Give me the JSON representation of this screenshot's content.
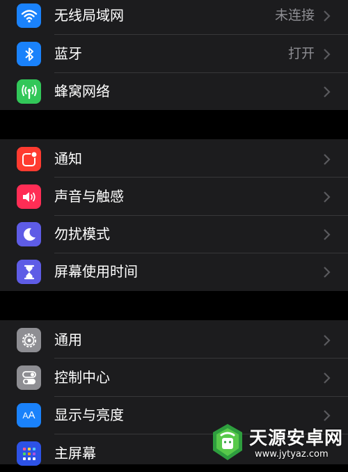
{
  "groups": [
    {
      "rows": [
        {
          "label": "无线局域网",
          "value": "未连接",
          "icon": "wifi-icon",
          "color": "#1a82fb"
        },
        {
          "label": "蓝牙",
          "value": "打开",
          "icon": "bluetooth-icon",
          "color": "#1a82fb"
        },
        {
          "label": "蜂窝网络",
          "value": "",
          "icon": "cellular-antenna-icon",
          "color": "#32c759"
        }
      ]
    },
    {
      "rows": [
        {
          "label": "通知",
          "value": "",
          "icon": "notification-icon",
          "color": "#ff3b30"
        },
        {
          "label": "声音与触感",
          "value": "",
          "icon": "speaker-icon",
          "color": "#ff2d55"
        },
        {
          "label": "勿扰模式",
          "value": "",
          "icon": "moon-icon",
          "color": "#5e5ce6"
        },
        {
          "label": "屏幕使用时间",
          "value": "",
          "icon": "hourglass-icon",
          "color": "#5e5ce6"
        }
      ]
    },
    {
      "rows": [
        {
          "label": "通用",
          "value": "",
          "icon": "gear-icon",
          "color": "#8e8e93"
        },
        {
          "label": "控制中心",
          "value": "",
          "icon": "toggles-icon",
          "color": "#8e8e93"
        },
        {
          "label": "显示与亮度",
          "value": "",
          "icon": "text-size-icon",
          "color": "#1a82fb"
        },
        {
          "label": "主屏幕",
          "value": "",
          "icon": "home-screen-grid-icon",
          "color": "#2d52e6"
        }
      ]
    }
  ],
  "watermark": {
    "title": "天源安卓网",
    "url": "www.jytyaz.com"
  },
  "colors": {
    "background": "#000000",
    "cell": "#1c1c1e",
    "separator": "#38383a",
    "text": "#ffffff",
    "secondary": "#8e8e93"
  }
}
